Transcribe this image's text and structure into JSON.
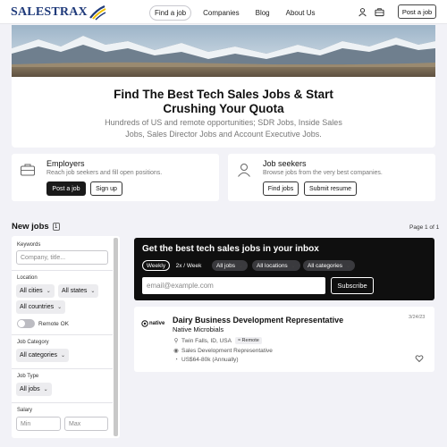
{
  "header": {
    "logo_text": "SALESTRAX",
    "nav": [
      {
        "label": "Find a job",
        "active": true
      },
      {
        "label": "Companies",
        "active": false
      },
      {
        "label": "Blog",
        "active": false
      },
      {
        "label": "About Us",
        "active": false
      }
    ],
    "icons": [
      "user-icon",
      "briefcase-icon"
    ],
    "post_job_label": "Post a job"
  },
  "hero": {
    "title": "Find The Best Tech Sales Jobs & Start Crushing Your Quota",
    "subtitle": "Hundreds of US and remote opportunities; SDR Jobs, Inside Sales Jobs, Sales Director Jobs and Account Executive Jobs."
  },
  "employers": {
    "title": "Employers",
    "description": "Reach job seekers and fill open positions.",
    "primary_label": "Post a job",
    "secondary_label": "Sign up"
  },
  "seekers": {
    "title": "Job seekers",
    "description": "Browse jobs from the very best companies.",
    "primary_label": "Find jobs",
    "secondary_label": "Submit resume"
  },
  "jobs_header": {
    "title": "New jobs",
    "count": "1",
    "page_info": "Page 1 of 1"
  },
  "filters": {
    "keywords_label": "Keywords",
    "keywords_placeholder": "Company, title...",
    "location_label": "Location",
    "all_cities": "All cities",
    "all_states": "All states",
    "all_countries": "All countries",
    "remote_ok_label": "Remote OK",
    "remote_ok": false,
    "job_category_label": "Job Category",
    "all_categories": "All categories",
    "job_type_label": "Job Type",
    "all_jobs": "All jobs",
    "salary_label": "Salary",
    "min_placeholder": "Min",
    "max_placeholder": "Max"
  },
  "subscribe": {
    "title": "Get the best tech sales jobs in your inbox",
    "frequency": [
      {
        "label": "Weekly",
        "selected": true
      },
      {
        "label": "2x / Week",
        "selected": false
      }
    ],
    "chips": [
      "All jobs",
      "All locations",
      "All categories"
    ],
    "email_placeholder": "email@example.com",
    "button_label": "Subscribe"
  },
  "job": {
    "logo_text": "native",
    "title": "Dairy Business Development Representative",
    "company": "Native Microbials",
    "location": "Twin Falls, ID, USA",
    "remote_badge": "Remote",
    "category": "Sales Development Representative",
    "salary": "US$64-80k (Annually)",
    "date": "3/24/23"
  },
  "colors": {
    "page_bg": "#f2f2f7",
    "dark": "#0f0f0f",
    "logo_blue": "#1f3a7a",
    "logo_yellow": "#f2c300"
  }
}
